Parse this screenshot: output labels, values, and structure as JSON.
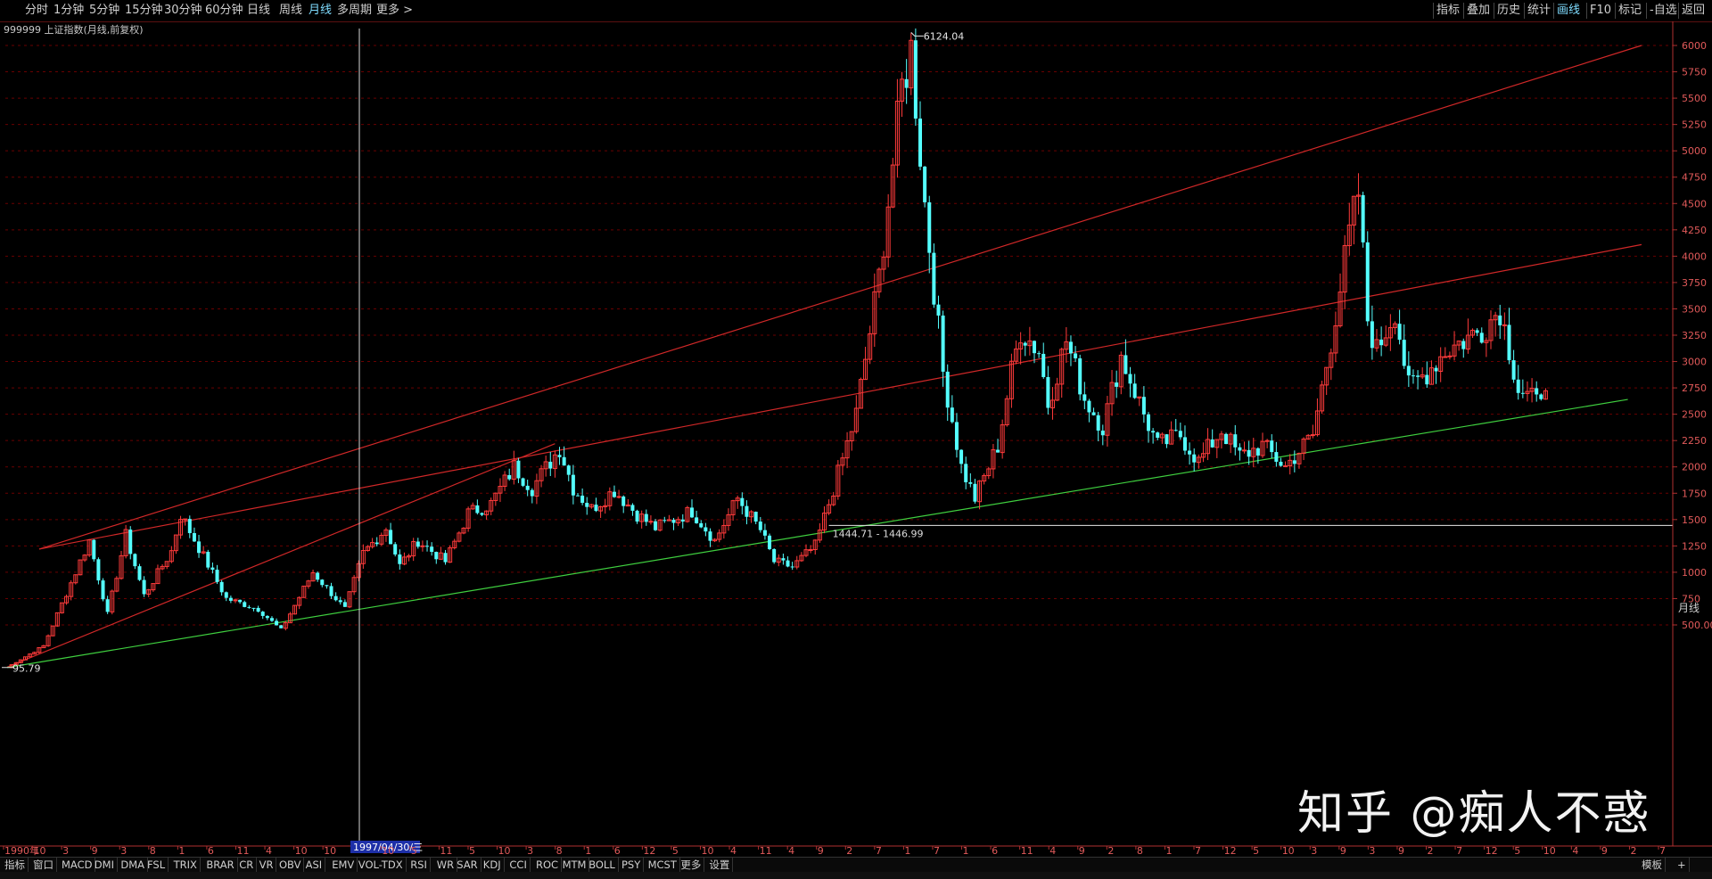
{
  "toolbar": {
    "periods": [
      "分时",
      "1分钟",
      "5分钟",
      "15分钟",
      "30分钟",
      "60分钟",
      "日线",
      "周线",
      "月线",
      "多周期",
      "更多 >"
    ],
    "active_period": "月线",
    "right_tools": [
      "指标",
      "叠加",
      "历史",
      "统计",
      "画线",
      "F10",
      "标记",
      "-自选",
      "返回"
    ]
  },
  "chart_title": "999999 上证指数(月线,前复权)",
  "period_label": "月线",
  "crosshair_date": "1997/04/30/三",
  "bottom_tabs": [
    "指标",
    "窗口",
    "MACD",
    "DMI",
    "DMA",
    "FSL",
    "TRIX",
    "BRAR",
    "CR",
    "VR",
    "OBV",
    "ASI",
    "EMV",
    "VOL-TDX",
    "RSI",
    "WR",
    "SAR",
    "KDJ",
    "CCI",
    "ROC",
    "MTM",
    "BOLL",
    "PSY",
    "MCST",
    "更多",
    "设置"
  ],
  "bottom_right": [
    "模板",
    "+"
  ],
  "watermark": "知乎 @痴人不惑",
  "colors": {
    "up": "#ff3b3b",
    "down": "#54ffff",
    "grid": "#6a0000",
    "axis": "#b03030",
    "support": "#3fcf3f"
  },
  "chart_data": {
    "type": "candlestick",
    "title": "999999 上证指数(月线,前复权)",
    "y_ticks": [
      500,
      750,
      1000,
      1250,
      1500,
      1750,
      2000,
      2250,
      2500,
      2750,
      3000,
      3250,
      3500,
      3750,
      4000,
      4250,
      4500,
      4750,
      5000,
      5250,
      5500,
      5750,
      6000
    ],
    "y_tick_labels": [
      "500.00",
      "750",
      "1000",
      "1250",
      "1500",
      "1750",
      "2000",
      "2250",
      "2500",
      "2750",
      "3000",
      "3250",
      "3500",
      "3750",
      "4000",
      "4250",
      "4500",
      "4750",
      "5000",
      "5250",
      "5500",
      "5750",
      "6000"
    ],
    "ylim": [
      250,
      6300
    ],
    "x_tick_labels": [
      "1990年",
      "10",
      "3",
      "9",
      "3",
      "8",
      "1",
      "6",
      "11",
      "4",
      "10",
      "10",
      "1997/04/30/三",
      "10",
      "5",
      "11",
      "5",
      "10",
      "3",
      "8",
      "1",
      "6",
      "12",
      "5",
      "10",
      "4",
      "11",
      "4",
      "9",
      "2",
      "7",
      "1",
      "7",
      "1",
      "6",
      "11",
      "4",
      "9",
      "2",
      "8",
      "1",
      "7",
      "12",
      "5",
      "10",
      "3",
      "9",
      "3",
      "9",
      "2",
      "7",
      "12",
      "5",
      "10",
      "4",
      "9",
      "2",
      "7"
    ],
    "annotations": {
      "high_label": "6124.04",
      "low_label": "95.79",
      "range_label": "1444.71 - 1446.99",
      "range_line_value": 1445
    },
    "months": 337,
    "series": [
      {
        "name": "candles",
        "anchors": [
          [
            0,
            96
          ],
          [
            8,
            300
          ],
          [
            18,
            1300
          ],
          [
            22,
            600
          ],
          [
            26,
            1350
          ],
          [
            30,
            780
          ],
          [
            36,
            1200
          ],
          [
            38,
            1550
          ],
          [
            48,
            750
          ],
          [
            55,
            650
          ],
          [
            60,
            450
          ],
          [
            67,
            1000
          ],
          [
            74,
            650
          ],
          [
            78,
            1180
          ],
          [
            83,
            1420
          ],
          [
            86,
            1060
          ],
          [
            90,
            1300
          ],
          [
            96,
            1100
          ],
          [
            101,
            1560
          ],
          [
            106,
            1650
          ],
          [
            111,
            2000
          ],
          [
            115,
            1800
          ],
          [
            119,
            2050
          ],
          [
            121,
            2180
          ],
          [
            124,
            1800
          ],
          [
            128,
            1600
          ],
          [
            133,
            1780
          ],
          [
            138,
            1550
          ],
          [
            142,
            1420
          ],
          [
            150,
            1580
          ],
          [
            155,
            1300
          ],
          [
            160,
            1700
          ],
          [
            165,
            1400
          ],
          [
            168,
            1100
          ],
          [
            172,
            1050
          ],
          [
            177,
            1250
          ],
          [
            180,
            1650
          ],
          [
            186,
            2500
          ],
          [
            191,
            3800
          ],
          [
            196,
            5600
          ],
          [
            198,
            5954
          ],
          [
            201,
            4500
          ],
          [
            205,
            2900
          ],
          [
            209,
            2000
          ],
          [
            212,
            1700
          ],
          [
            217,
            2200
          ],
          [
            220,
            2900
          ],
          [
            222,
            3300
          ],
          [
            226,
            3100
          ],
          [
            228,
            2600
          ],
          [
            232,
            3200
          ],
          [
            236,
            2650
          ],
          [
            240,
            2380
          ],
          [
            244,
            3050
          ],
          [
            249,
            2500
          ],
          [
            252,
            2200
          ],
          [
            257,
            2300
          ],
          [
            261,
            2050
          ],
          [
            266,
            2350
          ],
          [
            270,
            2100
          ],
          [
            275,
            2200
          ],
          [
            280,
            2000
          ],
          [
            286,
            2300
          ],
          [
            290,
            3200
          ],
          [
            294,
            4200
          ],
          [
            296,
            4600
          ],
          [
            298,
            3400
          ],
          [
            300,
            3100
          ],
          [
            304,
            3500
          ],
          [
            307,
            2750
          ],
          [
            311,
            2900
          ],
          [
            315,
            3100
          ],
          [
            319,
            3200
          ],
          [
            323,
            3300
          ],
          [
            327,
            3500
          ],
          [
            331,
            2750
          ],
          [
            335,
            2600
          ],
          [
            339,
            3100
          ],
          [
            343,
            2950
          ],
          [
            346,
            2900
          ],
          [
            349,
            2750
          ],
          [
            352,
            2800
          ],
          [
            356,
            3400
          ],
          [
            358,
            3250
          ]
        ]
      }
    ],
    "lines": [
      {
        "name": "upper-red-line",
        "from": [
          0,
          1220
        ],
        "to": [
          358,
          6000
        ]
      },
      {
        "name": "middle-red-line",
        "from": [
          0,
          1220
        ],
        "to": [
          358,
          4110
        ]
      },
      {
        "name": "steep-red-line",
        "from": [
          0,
          100
        ],
        "to": [
          120,
          2220
        ]
      },
      {
        "name": "green-support-line",
        "from": [
          0,
          96
        ],
        "to": [
          355,
          2640
        ]
      }
    ]
  }
}
